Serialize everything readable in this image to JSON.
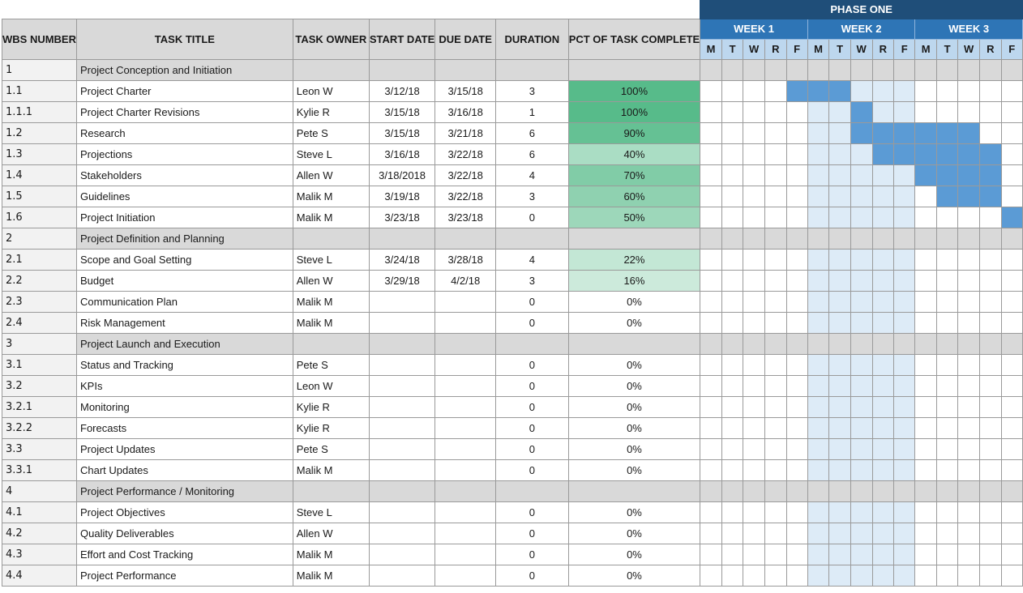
{
  "phase_label": "PHASE ONE",
  "headers": {
    "wbs": "WBS NUMBER",
    "title": "TASK TITLE",
    "owner": "TASK OWNER",
    "start": "START DATE",
    "due": "DUE DATE",
    "duration": "DURATION",
    "pct": "PCT OF TASK COMPLETE"
  },
  "weeks": [
    "WEEK 1",
    "WEEK 2",
    "WEEK 3"
  ],
  "days": [
    "M",
    "T",
    "W",
    "R",
    "F",
    "M",
    "T",
    "W",
    "R",
    "F",
    "M",
    "T",
    "W",
    "R",
    "F"
  ],
  "colors": {
    "phase_bg": "#1f4e79",
    "week_bg": "#2e75b6",
    "day_bg": "#bdd7ee",
    "bar": "#5b9bd5",
    "week2_shade": "#ddebf7",
    "section_bg": "#d9d9d9"
  },
  "rows": [
    {
      "wbs": "1",
      "title": "Project Conception and Initiation",
      "section": true
    },
    {
      "wbs": "1.1",
      "title": "Project Charter",
      "owner": "Leon W",
      "start": "3/12/18",
      "due": "3/15/18",
      "duration": "3",
      "pct": "100%",
      "pct_value": 100,
      "bar": [
        4,
        6
      ]
    },
    {
      "wbs": "1.1.1",
      "title": "Project Charter Revisions",
      "owner": "Kylie R",
      "start": "3/15/18",
      "due": "3/16/18",
      "duration": "1",
      "pct": "100%",
      "pct_value": 100,
      "bar": [
        7,
        7
      ]
    },
    {
      "wbs": "1.2",
      "title": "Research",
      "owner": "Pete S",
      "start": "3/15/18",
      "due": "3/21/18",
      "duration": "6",
      "pct": "90%",
      "pct_value": 90,
      "bar": [
        7,
        12
      ]
    },
    {
      "wbs": "1.3",
      "title": "Projections",
      "owner": "Steve L",
      "start": "3/16/18",
      "due": "3/22/18",
      "duration": "6",
      "pct": "40%",
      "pct_value": 40,
      "bar": [
        8,
        13
      ]
    },
    {
      "wbs": "1.4",
      "title": "Stakeholders",
      "owner": "Allen W",
      "start": "3/18/2018",
      "due": "3/22/18",
      "duration": "4",
      "pct": "70%",
      "pct_value": 70,
      "bar": [
        10,
        13
      ]
    },
    {
      "wbs": "1.5",
      "title": "Guidelines",
      "owner": "Malik M",
      "start": "3/19/18",
      "due": "3/22/18",
      "duration": "3",
      "pct": "60%",
      "pct_value": 60,
      "bar": [
        11,
        13
      ]
    },
    {
      "wbs": "1.6",
      "title": "Project Initiation",
      "owner": "Malik M",
      "start": "3/23/18",
      "due": "3/23/18",
      "duration": "0",
      "pct": "50%",
      "pct_value": 50,
      "bar": [
        14,
        14
      ]
    },
    {
      "wbs": "2",
      "title": "Project Definition and Planning",
      "section": true
    },
    {
      "wbs": "2.1",
      "title": "Scope and Goal Setting",
      "owner": "Steve L",
      "start": "3/24/18",
      "due": "3/28/18",
      "duration": "4",
      "pct": "22%",
      "pct_value": 22
    },
    {
      "wbs": "2.2",
      "title": "Budget",
      "owner": "Allen W",
      "start": "3/29/18",
      "due": "4/2/18",
      "duration": "3",
      "pct": "16%",
      "pct_value": 16
    },
    {
      "wbs": "2.3",
      "title": "Communication Plan",
      "owner": "Malik M",
      "start": "",
      "due": "",
      "duration": "0",
      "pct": "0%",
      "pct_value": 0
    },
    {
      "wbs": "2.4",
      "title": "Risk Management",
      "owner": "Malik M",
      "start": "",
      "due": "",
      "duration": "0",
      "pct": "0%",
      "pct_value": 0
    },
    {
      "wbs": "3",
      "title": "Project Launch and Execution",
      "section": true
    },
    {
      "wbs": "3.1",
      "title": "Status and Tracking",
      "owner": "Pete S",
      "start": "",
      "due": "",
      "duration": "0",
      "pct": "0%",
      "pct_value": 0
    },
    {
      "wbs": "3.2",
      "title": "KPIs",
      "owner": "Leon W",
      "start": "",
      "due": "",
      "duration": "0",
      "pct": "0%",
      "pct_value": 0
    },
    {
      "wbs": "3.2.1",
      "title": "Monitoring",
      "owner": "Kylie R",
      "start": "",
      "due": "",
      "duration": "0",
      "pct": "0%",
      "pct_value": 0
    },
    {
      "wbs": "3.2.2",
      "title": "Forecasts",
      "owner": "Kylie R",
      "start": "",
      "due": "",
      "duration": "0",
      "pct": "0%",
      "pct_value": 0
    },
    {
      "wbs": "3.3",
      "title": "Project Updates",
      "owner": "Pete S",
      "start": "",
      "due": "",
      "duration": "0",
      "pct": "0%",
      "pct_value": 0
    },
    {
      "wbs": "3.3.1",
      "title": "Chart Updates",
      "owner": "Malik M",
      "start": "",
      "due": "",
      "duration": "0",
      "pct": "0%",
      "pct_value": 0
    },
    {
      "wbs": "4",
      "title": "Project Performance / Monitoring",
      "section": true
    },
    {
      "wbs": "4.1",
      "title": "Project Objectives",
      "owner": "Steve L",
      "start": "",
      "due": "",
      "duration": "0",
      "pct": "0%",
      "pct_value": 0
    },
    {
      "wbs": "4.2",
      "title": "Quality Deliverables",
      "owner": "Allen W",
      "start": "",
      "due": "",
      "duration": "0",
      "pct": "0%",
      "pct_value": 0
    },
    {
      "wbs": "4.3",
      "title": "Effort and Cost Tracking",
      "owner": "Malik M",
      "start": "",
      "due": "",
      "duration": "0",
      "pct": "0%",
      "pct_value": 0
    },
    {
      "wbs": "4.4",
      "title": "Project Performance",
      "owner": "Malik M",
      "start": "",
      "due": "",
      "duration": "0",
      "pct": "0%",
      "pct_value": 0
    }
  ]
}
